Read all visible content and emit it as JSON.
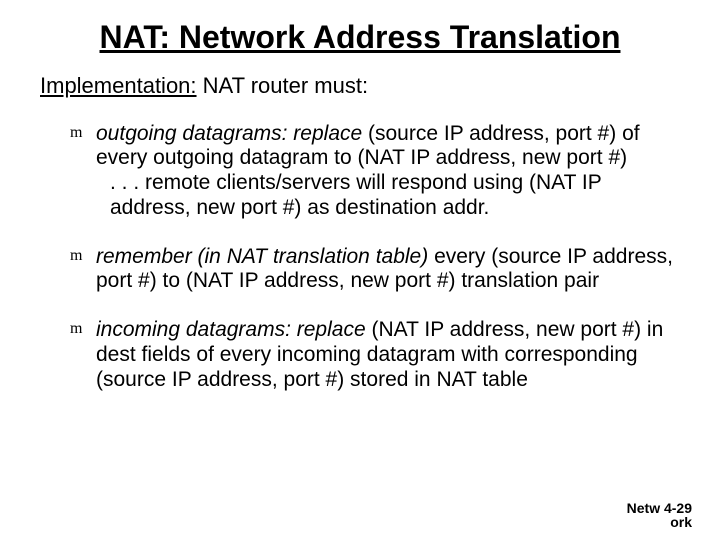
{
  "title": "NAT: Network Address Translation",
  "subtitle_lead": "Implementation:",
  "subtitle_rest": " NAT router must:",
  "bullets": [
    {
      "marker": "m",
      "lead": "outgoing datagrams: replace",
      "body": " (source IP address, port #) of every outgoing datagram to (NAT IP address, new port #)",
      "cont": ". . . remote clients/servers will respond using (NAT IP address, new port #) as destination addr."
    },
    {
      "marker": "m",
      "lead": "remember (in NAT translation table)",
      "body": " every (source IP address, port #)  to (NAT IP address, new port #) translation pair",
      "cont": ""
    },
    {
      "marker": "m",
      "lead": "incoming datagrams: replace",
      "body": " (NAT IP address, new port #) in dest fields of every incoming datagram with corresponding (source IP address, port #) stored in NAT table",
      "cont": ""
    }
  ],
  "footer_line1": "Netw 4-29",
  "footer_line2": "ork"
}
